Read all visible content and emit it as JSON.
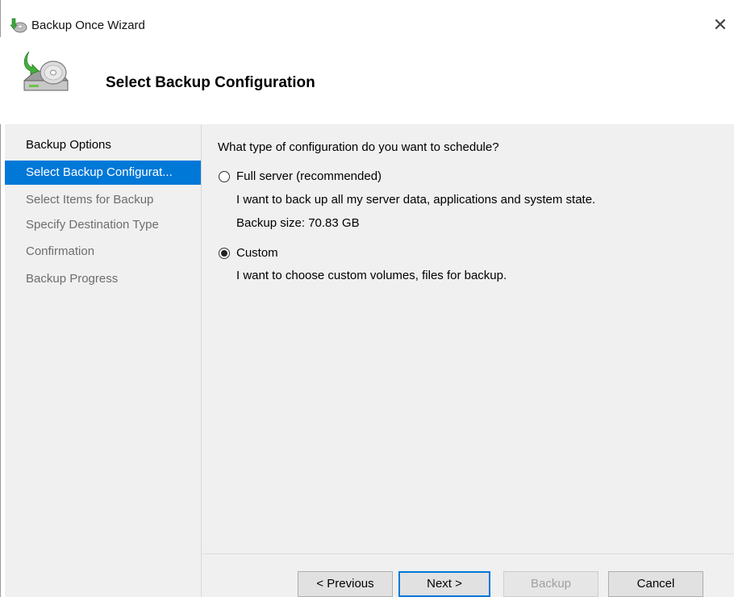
{
  "window": {
    "title": "Backup Once Wizard",
    "close_glyph": "✕",
    "icon": "backup-wizard-icon"
  },
  "header": {
    "title": "Select Backup Configuration",
    "icon": "backup-disk-icon"
  },
  "nav": {
    "items": [
      {
        "label": "Backup Options",
        "state": "done"
      },
      {
        "label": "Select Backup Configurat...",
        "state": "active"
      },
      {
        "label": "Select Items for Backup",
        "state": "pending"
      },
      {
        "label": "Specify Destination Type",
        "state": "pending"
      },
      {
        "label": "Confirmation",
        "state": "pending"
      },
      {
        "label": "Backup Progress",
        "state": "pending"
      }
    ]
  },
  "main": {
    "question": "What type of configuration do you want to schedule?",
    "options": [
      {
        "label": "Full server (recommended)",
        "description": "I want to back up all my server data, applications and system state.",
        "extra": "Backup size: 70.83 GB",
        "selected": false
      },
      {
        "label": "Custom",
        "description": "I want to choose custom volumes, files for backup.",
        "selected": true
      }
    ]
  },
  "buttons": {
    "previous": "< Previous",
    "next": "Next >",
    "backup": "Backup",
    "cancel": "Cancel"
  },
  "colors": {
    "accent": "#0078d7",
    "panel_background": "#f0f0f0",
    "disabled_text": "#a0a0a0"
  }
}
